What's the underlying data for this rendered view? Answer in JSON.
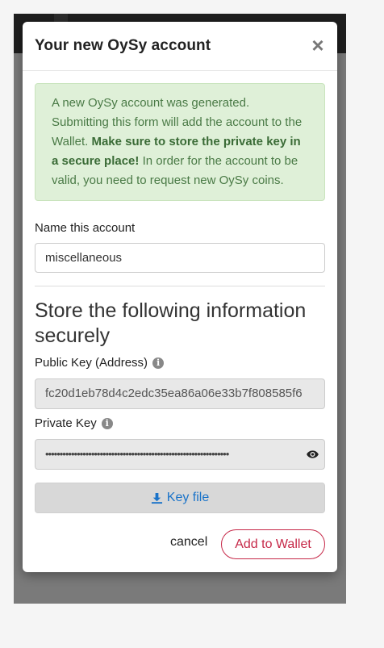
{
  "modal": {
    "title": "Your new OySy account",
    "close_symbol": "×"
  },
  "alert": {
    "text_before": "A new OySy account was generated. Submitting this form will add the account to the Wallet. ",
    "text_bold": "Make sure to store the private key in a secure place!",
    "text_after": " In order for the account to be valid, you need to request new OySy coins."
  },
  "name_field": {
    "label": "Name this account",
    "value": "miscellaneous"
  },
  "section_title": "Store the following information securely",
  "public_key": {
    "label": "Public Key (Address)",
    "value": "fc20d1eb78d4c2edc35ea86a06e33b7f808585f6"
  },
  "private_key": {
    "label": "Private Key",
    "masked_value": "••••••••••••••••••••••••••••••••••••••••••••••••••••••••••••••••"
  },
  "icons": {
    "info": "i",
    "eye": "eye-icon",
    "download": "download-icon"
  },
  "buttons": {
    "key_file": "Key file",
    "cancel": "cancel",
    "add": "Add to Wallet"
  },
  "colors": {
    "accent_link": "#1a73c9",
    "danger": "#c62848",
    "alert_bg": "#dff0d8"
  }
}
